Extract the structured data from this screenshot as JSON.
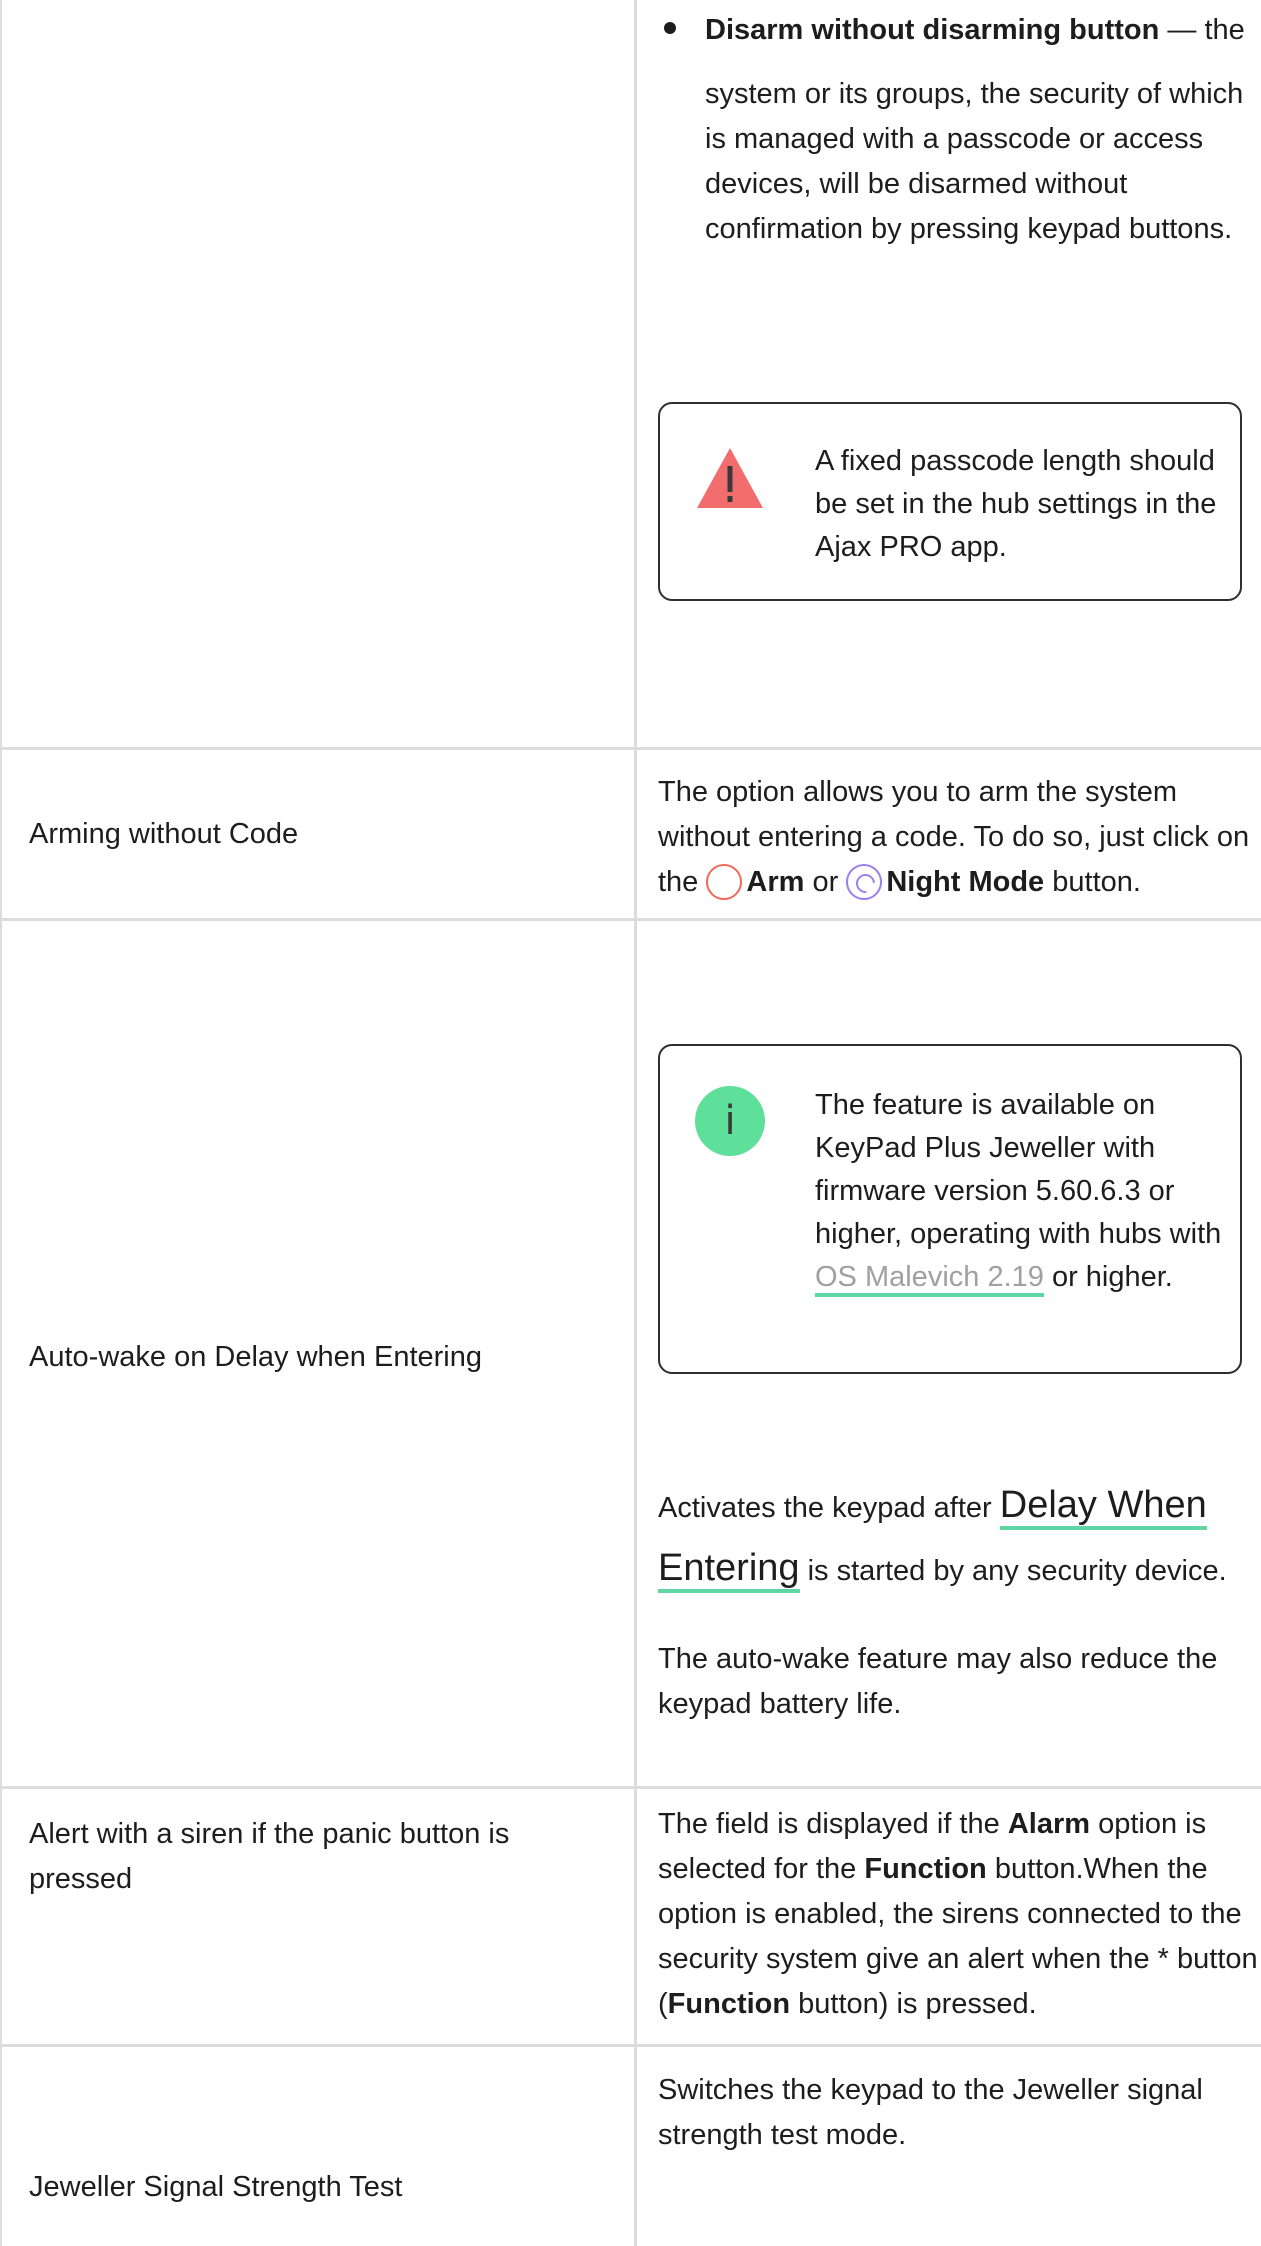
{
  "rows": {
    "disarm": {
      "bullet_title": "Disarm without disarming button",
      "bullet_dash": " — the",
      "bullet_body": "system or its groups, the security of which is managed with a passcode or access devices, will be disarmed without confirmation by pressing keypad buttons.",
      "warning": "A fixed passcode length should be set in the hub settings in the Ajax PRO app."
    },
    "arming": {
      "label": "Arming without Code",
      "desc_pre": "The option allows you to arm the system without entering a code. To do so, just click on the",
      "arm": "Arm",
      "or": "or",
      "night": "Night Mode",
      "desc_post": "button."
    },
    "autowake": {
      "label": "Auto-wake on Delay when Entering",
      "info_pre": "The feature is available on KeyPad Plus Jeweller with firmware version 5.60.6.3 or higher, operating with hubs with",
      "info_link": "OS Malevich 2.19",
      "info_post": "or higher.",
      "p1_pre": "Activates the keypad after",
      "p1_link_a": "Delay When",
      "p1_link_b": "Entering",
      "p1_post": "is started by any security device.",
      "p2": "The auto-wake feature may also reduce the keypad battery life."
    },
    "panic": {
      "label": "Alert with a siren if the panic button is pressed",
      "t1": "The field is displayed if the",
      "b1": "Alarm",
      "t2": "option is selected for the",
      "b2": "Function",
      "t3": "button.When the option is enabled, the sirens connected to the security system give an alert when the * button (",
      "b3": "Function",
      "t4": "button) is pressed."
    },
    "signal": {
      "label": "Jeweller Signal Strength Test",
      "desc": "Switches the keypad to the Jeweller signal strength test mode."
    }
  },
  "colors": {
    "border": "#dcdcdc",
    "warning": "#f26d6d",
    "info": "#5fe09a",
    "link_underline": "#5fd6a6",
    "arm": "#f2695c",
    "night": "#9b7ff0"
  },
  "icons": {
    "warning": "warning-triangle-icon",
    "info": "info-icon",
    "arm": "arm-icon",
    "night": "night-mode-icon"
  }
}
